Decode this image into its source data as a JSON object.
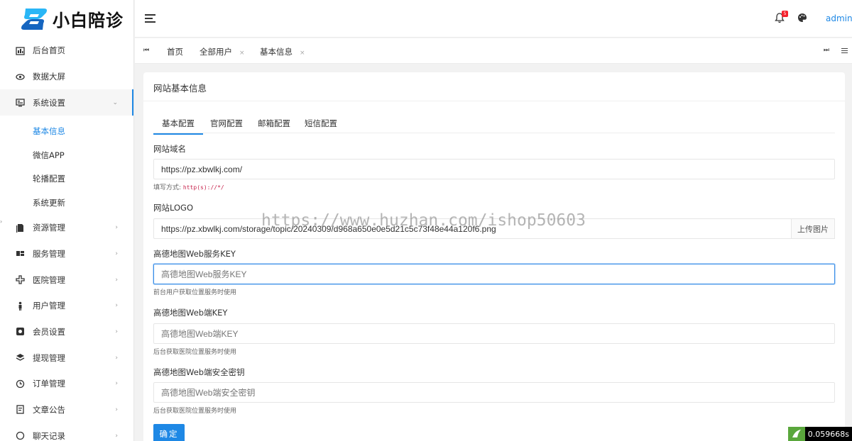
{
  "brand": {
    "name": "小白陪诊",
    "colors": {
      "accent": "#1e88e5",
      "logo_dark": "#1565c0",
      "logo_light": "#29b6f6"
    }
  },
  "sidebar": {
    "items": [
      {
        "icon": "dashboard-icon",
        "label": "后台首页"
      },
      {
        "icon": "eye-icon",
        "label": "数据大屏"
      },
      {
        "icon": "settings-panel-icon",
        "label": "系统设置",
        "expanded": true,
        "children": [
          {
            "label": "基本信息",
            "active": true
          },
          {
            "label": "微信APP"
          },
          {
            "label": "轮播配置"
          },
          {
            "label": "系统更新"
          }
        ]
      },
      {
        "icon": "document-icon",
        "label": "资源管理"
      },
      {
        "icon": "grid-icon",
        "label": "服务管理"
      },
      {
        "icon": "hospital-cross-icon",
        "label": "医院管理"
      },
      {
        "icon": "person-icon",
        "label": "用户管理"
      },
      {
        "icon": "member-card-icon",
        "label": "会员设置"
      },
      {
        "icon": "layers-icon",
        "label": "提现管理"
      },
      {
        "icon": "clock-icon",
        "label": "订单管理"
      },
      {
        "icon": "article-icon",
        "label": "文章公告"
      },
      {
        "icon": "chat-icon",
        "label": "聊天记录"
      }
    ]
  },
  "header": {
    "notification_count": "5",
    "user": "admin"
  },
  "page_tabs": [
    {
      "label": "首页",
      "closable": false
    },
    {
      "label": "全部用户",
      "closable": true
    },
    {
      "label": "基本信息",
      "closable": true
    }
  ],
  "close_glyph": "×",
  "card": {
    "title": "网站基本信息",
    "tabs": [
      "基本配置",
      "官网配置",
      "邮箱配置",
      "短信配置"
    ],
    "active_tab": 0,
    "fields": {
      "domain": {
        "label": "网站域名",
        "value": "https://pz.xbwlkj.com/",
        "hint_prefix": "填写方式:",
        "hint_code": "http(s)://*/"
      },
      "logo": {
        "label": "网站LOGO",
        "value": "https://pz.xbwlkj.com/storage/topic/20240309/d968a650e0e5d21c5c73f48e44a120f6.png",
        "button": "上传图片"
      },
      "amap_web_service_key": {
        "label": "高德地图Web服务KEY",
        "placeholder": "高德地图Web服务KEY",
        "hint": "前台用户获取位置服务时使用"
      },
      "amap_web_key": {
        "label": "高德地图Web端KEY",
        "placeholder": "高德地图Web端KEY",
        "hint": "后台获取医院位置服务时使用"
      },
      "amap_web_secret": {
        "label": "高德地图Web端安全密钥",
        "placeholder": "高德地图Web端安全密钥",
        "hint": "后台获取医院位置服务时使用"
      }
    },
    "submit": "确定"
  },
  "watermark": "https://www.huzhan.com/ishop50603",
  "timer": "0.059668s"
}
